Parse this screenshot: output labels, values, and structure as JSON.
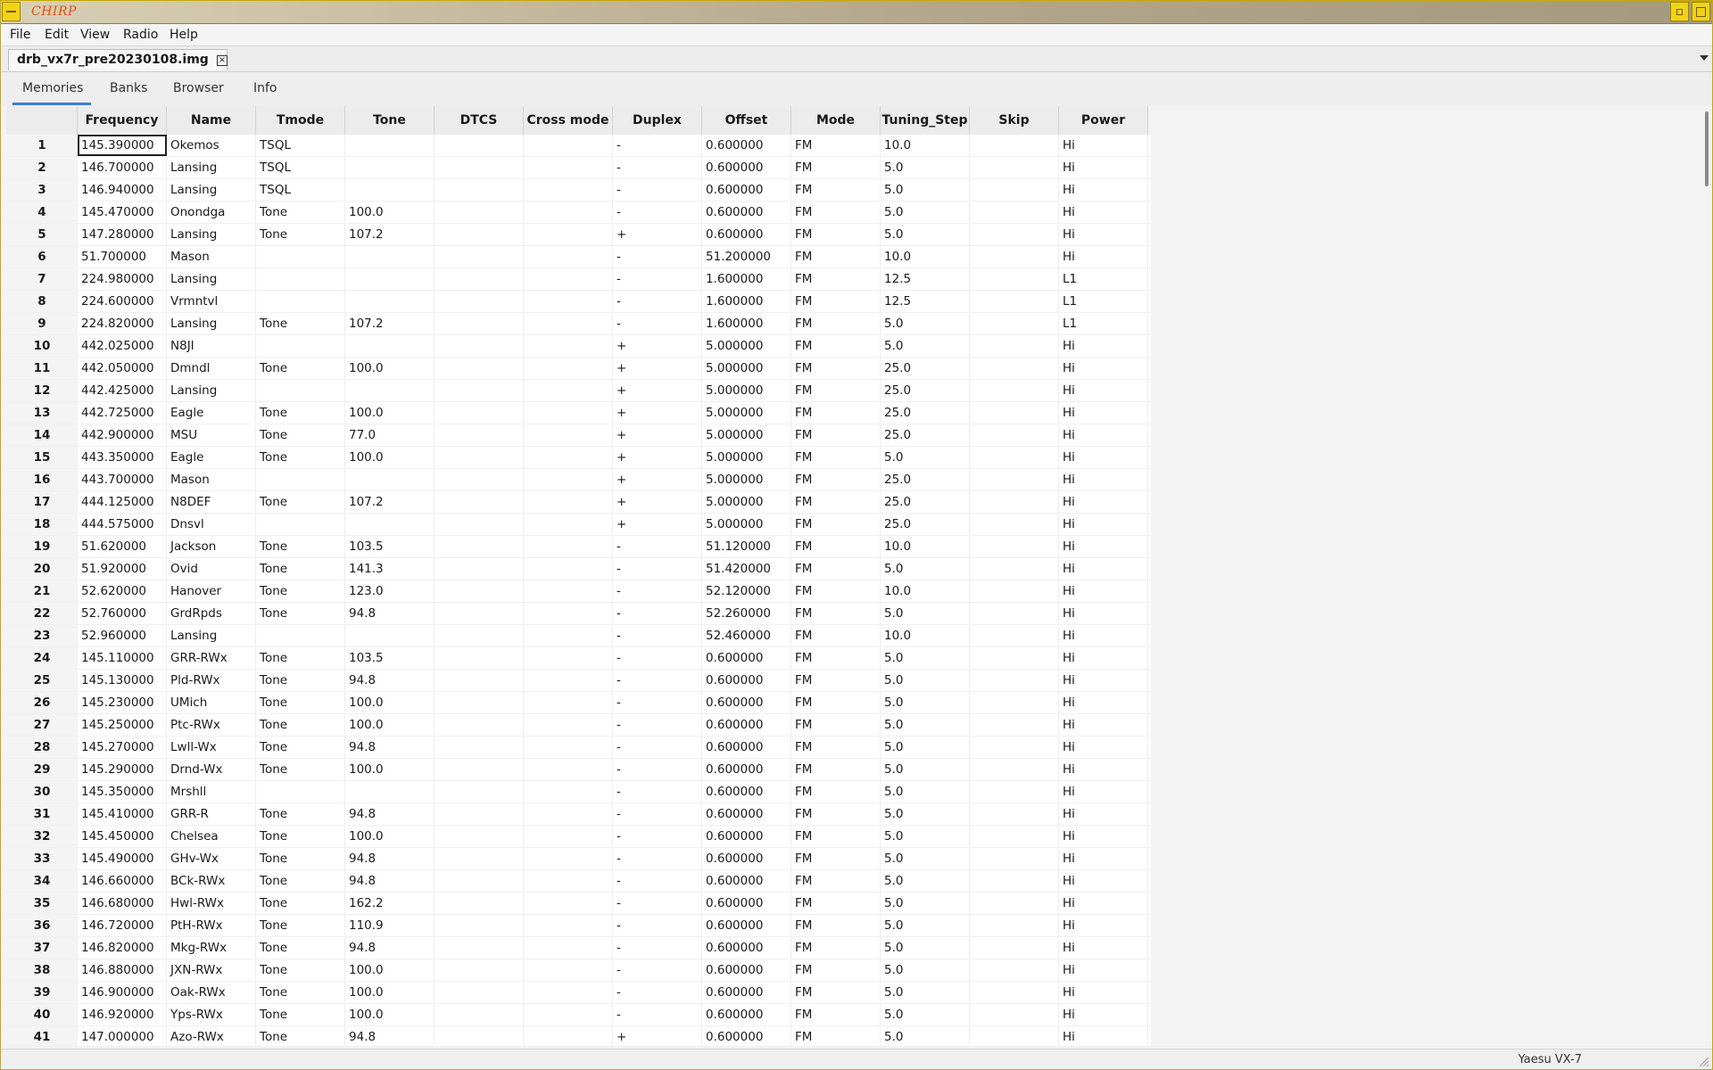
{
  "window": {
    "title": "CHIRP",
    "icons": {
      "menu": "window-menu-icon",
      "minimize": "minimize-icon",
      "maximize": "maximize-icon"
    }
  },
  "menubar": [
    "File",
    "Edit",
    "View",
    "Radio",
    "Help"
  ],
  "file_tab": {
    "label": "drb_vx7r_pre20230108.img",
    "close_icon": "close-icon"
  },
  "tabs": [
    "Memories",
    "Banks",
    "Browser",
    "Info"
  ],
  "active_tab": "Memories",
  "columns": [
    "Frequency",
    "Name",
    "Tmode",
    "Tone",
    "DTCS",
    "Cross mode",
    "Duplex",
    "Offset",
    "Mode",
    "Tuning_Step",
    "Skip",
    "Power"
  ],
  "rows": [
    [
      "1",
      "145.390000",
      "Okemos",
      "TSQL",
      "",
      "",
      "",
      "-",
      "0.600000",
      "FM",
      "10.0",
      "",
      "Hi"
    ],
    [
      "2",
      "146.700000",
      "Lansing",
      "TSQL",
      "",
      "",
      "",
      "-",
      "0.600000",
      "FM",
      "5.0",
      "",
      "Hi"
    ],
    [
      "3",
      "146.940000",
      "Lansing",
      "TSQL",
      "",
      "",
      "",
      "-",
      "0.600000",
      "FM",
      "5.0",
      "",
      "Hi"
    ],
    [
      "4",
      "145.470000",
      "Onondga",
      "Tone",
      "100.0",
      "",
      "",
      "-",
      "0.600000",
      "FM",
      "5.0",
      "",
      "Hi"
    ],
    [
      "5",
      "147.280000",
      "Lansing",
      "Tone",
      "107.2",
      "",
      "",
      "+",
      "0.600000",
      "FM",
      "5.0",
      "",
      "Hi"
    ],
    [
      "6",
      "51.700000",
      "Mason",
      "",
      "",
      "",
      "",
      "-",
      "51.200000",
      "FM",
      "10.0",
      "",
      "Hi"
    ],
    [
      "7",
      "224.980000",
      "Lansing",
      "",
      "",
      "",
      "",
      "-",
      "1.600000",
      "FM",
      "12.5",
      "",
      "L1"
    ],
    [
      "8",
      "224.600000",
      "Vrmntvl",
      "",
      "",
      "",
      "",
      "-",
      "1.600000",
      "FM",
      "12.5",
      "",
      "L1"
    ],
    [
      "9",
      "224.820000",
      "Lansing",
      "Tone",
      "107.2",
      "",
      "",
      "-",
      "1.600000",
      "FM",
      "5.0",
      "",
      "L1"
    ],
    [
      "10",
      "442.025000",
      "N8JI",
      "",
      "",
      "",
      "",
      "+",
      "5.000000",
      "FM",
      "5.0",
      "",
      "Hi"
    ],
    [
      "11",
      "442.050000",
      "Dmndl",
      "Tone",
      "100.0",
      "",
      "",
      "+",
      "5.000000",
      "FM",
      "25.0",
      "",
      "Hi"
    ],
    [
      "12",
      "442.425000",
      "Lansing",
      "",
      "",
      "",
      "",
      "+",
      "5.000000",
      "FM",
      "25.0",
      "",
      "Hi"
    ],
    [
      "13",
      "442.725000",
      "Eagle",
      "Tone",
      "100.0",
      "",
      "",
      "+",
      "5.000000",
      "FM",
      "25.0",
      "",
      "Hi"
    ],
    [
      "14",
      "442.900000",
      "MSU",
      "Tone",
      "77.0",
      "",
      "",
      "+",
      "5.000000",
      "FM",
      "25.0",
      "",
      "Hi"
    ],
    [
      "15",
      "443.350000",
      "Eagle",
      "Tone",
      "100.0",
      "",
      "",
      "+",
      "5.000000",
      "FM",
      "5.0",
      "",
      "Hi"
    ],
    [
      "16",
      "443.700000",
      "Mason",
      "",
      "",
      "",
      "",
      "+",
      "5.000000",
      "FM",
      "25.0",
      "",
      "Hi"
    ],
    [
      "17",
      "444.125000",
      "N8DEF",
      "Tone",
      "107.2",
      "",
      "",
      "+",
      "5.000000",
      "FM",
      "25.0",
      "",
      "Hi"
    ],
    [
      "18",
      "444.575000",
      "Dnsvl",
      "",
      "",
      "",
      "",
      "+",
      "5.000000",
      "FM",
      "25.0",
      "",
      "Hi"
    ],
    [
      "19",
      "51.620000",
      "Jackson",
      "Tone",
      "103.5",
      "",
      "",
      "-",
      "51.120000",
      "FM",
      "10.0",
      "",
      "Hi"
    ],
    [
      "20",
      "51.920000",
      "Ovid",
      "Tone",
      "141.3",
      "",
      "",
      "-",
      "51.420000",
      "FM",
      "5.0",
      "",
      "Hi"
    ],
    [
      "21",
      "52.620000",
      "Hanover",
      "Tone",
      "123.0",
      "",
      "",
      "-",
      "52.120000",
      "FM",
      "10.0",
      "",
      "Hi"
    ],
    [
      "22",
      "52.760000",
      "GrdRpds",
      "Tone",
      "94.8",
      "",
      "",
      "-",
      "52.260000",
      "FM",
      "5.0",
      "",
      "Hi"
    ],
    [
      "23",
      "52.960000",
      "Lansing",
      "",
      "",
      "",
      "",
      "-",
      "52.460000",
      "FM",
      "10.0",
      "",
      "Hi"
    ],
    [
      "24",
      "145.110000",
      "GRR-RWx",
      "Tone",
      "103.5",
      "",
      "",
      "-",
      "0.600000",
      "FM",
      "5.0",
      "",
      "Hi"
    ],
    [
      "25",
      "145.130000",
      "Pld-RWx",
      "Tone",
      "94.8",
      "",
      "",
      "-",
      "0.600000",
      "FM",
      "5.0",
      "",
      "Hi"
    ],
    [
      "26",
      "145.230000",
      "UMich",
      "Tone",
      "100.0",
      "",
      "",
      "-",
      "0.600000",
      "FM",
      "5.0",
      "",
      "Hi"
    ],
    [
      "27",
      "145.250000",
      "Ptc-RWx",
      "Tone",
      "100.0",
      "",
      "",
      "-",
      "0.600000",
      "FM",
      "5.0",
      "",
      "Hi"
    ],
    [
      "28",
      "145.270000",
      "Lwll-Wx",
      "Tone",
      "94.8",
      "",
      "",
      "-",
      "0.600000",
      "FM",
      "5.0",
      "",
      "Hi"
    ],
    [
      "29",
      "145.290000",
      "Drnd-Wx",
      "Tone",
      "100.0",
      "",
      "",
      "-",
      "0.600000",
      "FM",
      "5.0",
      "",
      "Hi"
    ],
    [
      "30",
      "145.350000",
      "Mrshll",
      "",
      "",
      "",
      "",
      "-",
      "0.600000",
      "FM",
      "5.0",
      "",
      "Hi"
    ],
    [
      "31",
      "145.410000",
      "GRR-R",
      "Tone",
      "94.8",
      "",
      "",
      "-",
      "0.600000",
      "FM",
      "5.0",
      "",
      "Hi"
    ],
    [
      "32",
      "145.450000",
      "Chelsea",
      "Tone",
      "100.0",
      "",
      "",
      "-",
      "0.600000",
      "FM",
      "5.0",
      "",
      "Hi"
    ],
    [
      "33",
      "145.490000",
      "GHv-Wx",
      "Tone",
      "94.8",
      "",
      "",
      "-",
      "0.600000",
      "FM",
      "5.0",
      "",
      "Hi"
    ],
    [
      "34",
      "146.660000",
      "BCk-RWx",
      "Tone",
      "94.8",
      "",
      "",
      "-",
      "0.600000",
      "FM",
      "5.0",
      "",
      "Hi"
    ],
    [
      "35",
      "146.680000",
      "Hwl-RWx",
      "Tone",
      "162.2",
      "",
      "",
      "-",
      "0.600000",
      "FM",
      "5.0",
      "",
      "Hi"
    ],
    [
      "36",
      "146.720000",
      "PtH-RWx",
      "Tone",
      "110.9",
      "",
      "",
      "-",
      "0.600000",
      "FM",
      "5.0",
      "",
      "Hi"
    ],
    [
      "37",
      "146.820000",
      "Mkg-RWx",
      "Tone",
      "94.8",
      "",
      "",
      "-",
      "0.600000",
      "FM",
      "5.0",
      "",
      "Hi"
    ],
    [
      "38",
      "146.880000",
      "JXN-RWx",
      "Tone",
      "100.0",
      "",
      "",
      "-",
      "0.600000",
      "FM",
      "5.0",
      "",
      "Hi"
    ],
    [
      "39",
      "146.900000",
      "Oak-RWx",
      "Tone",
      "100.0",
      "",
      "",
      "-",
      "0.600000",
      "FM",
      "5.0",
      "",
      "Hi"
    ],
    [
      "40",
      "146.920000",
      "Yps-RWx",
      "Tone",
      "100.0",
      "",
      "",
      "-",
      "0.600000",
      "FM",
      "5.0",
      "",
      "Hi"
    ],
    [
      "41",
      "147.000000",
      "Azo-RWx",
      "Tone",
      "94.8",
      "",
      "",
      "+",
      "0.600000",
      "FM",
      "5.0",
      "",
      "Hi"
    ]
  ],
  "status": {
    "radio_model": "Yaesu VX-7"
  }
}
